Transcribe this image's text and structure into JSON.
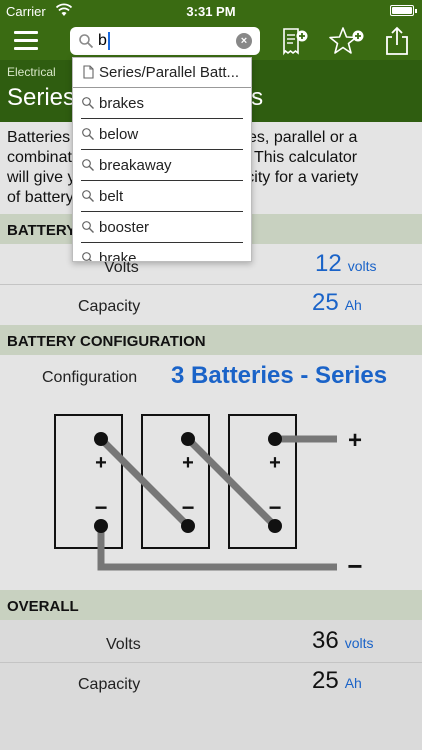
{
  "status_bar": {
    "carrier": "Carrier",
    "time": "3:31 PM"
  },
  "search": {
    "query": "b"
  },
  "breadcrumb": {
    "section": "Electrical",
    "title": "Series/Parallel Batteries"
  },
  "dropdown": {
    "items": [
      {
        "label": "Series/Parallel Batt...",
        "icon": "document-icon"
      },
      {
        "label": "brakes",
        "icon": "search-icon"
      },
      {
        "label": "below",
        "icon": "search-icon"
      },
      {
        "label": "breakaway",
        "icon": "search-icon"
      },
      {
        "label": "belt",
        "icon": "search-icon"
      },
      {
        "label": "booster",
        "icon": "search-icon"
      },
      {
        "label": "brake",
        "icon": "search-icon"
      }
    ]
  },
  "description": {
    "lines": [
      "Batteries can be connected in series, parallel or a",
      "combination of series and parallel. This calculator",
      "will give you the voltage and capacity for a variety",
      "of battery configurations."
    ]
  },
  "battery": {
    "header": "BATTERY",
    "volts_label": "Volts",
    "volts_value": "12",
    "volts_unit": "volts",
    "capacity_label": "Capacity",
    "capacity_value": "25",
    "capacity_unit": "Ah"
  },
  "configuration": {
    "header": "BATTERY CONFIGURATION",
    "label": "Configuration",
    "value": "3 Batteries - Series",
    "plus": "+",
    "minus": "−"
  },
  "overall": {
    "header": "OVERALL",
    "volts_label": "Volts",
    "volts_value": "36",
    "volts_unit": "volts",
    "capacity_label": "Capacity",
    "capacity_value": "25",
    "capacity_unit": "Ah"
  },
  "colors": {
    "nav": "#3a6b12",
    "header_band": "#2f5d10",
    "section": "#c8d1c0",
    "accent": "#1a63c8"
  }
}
